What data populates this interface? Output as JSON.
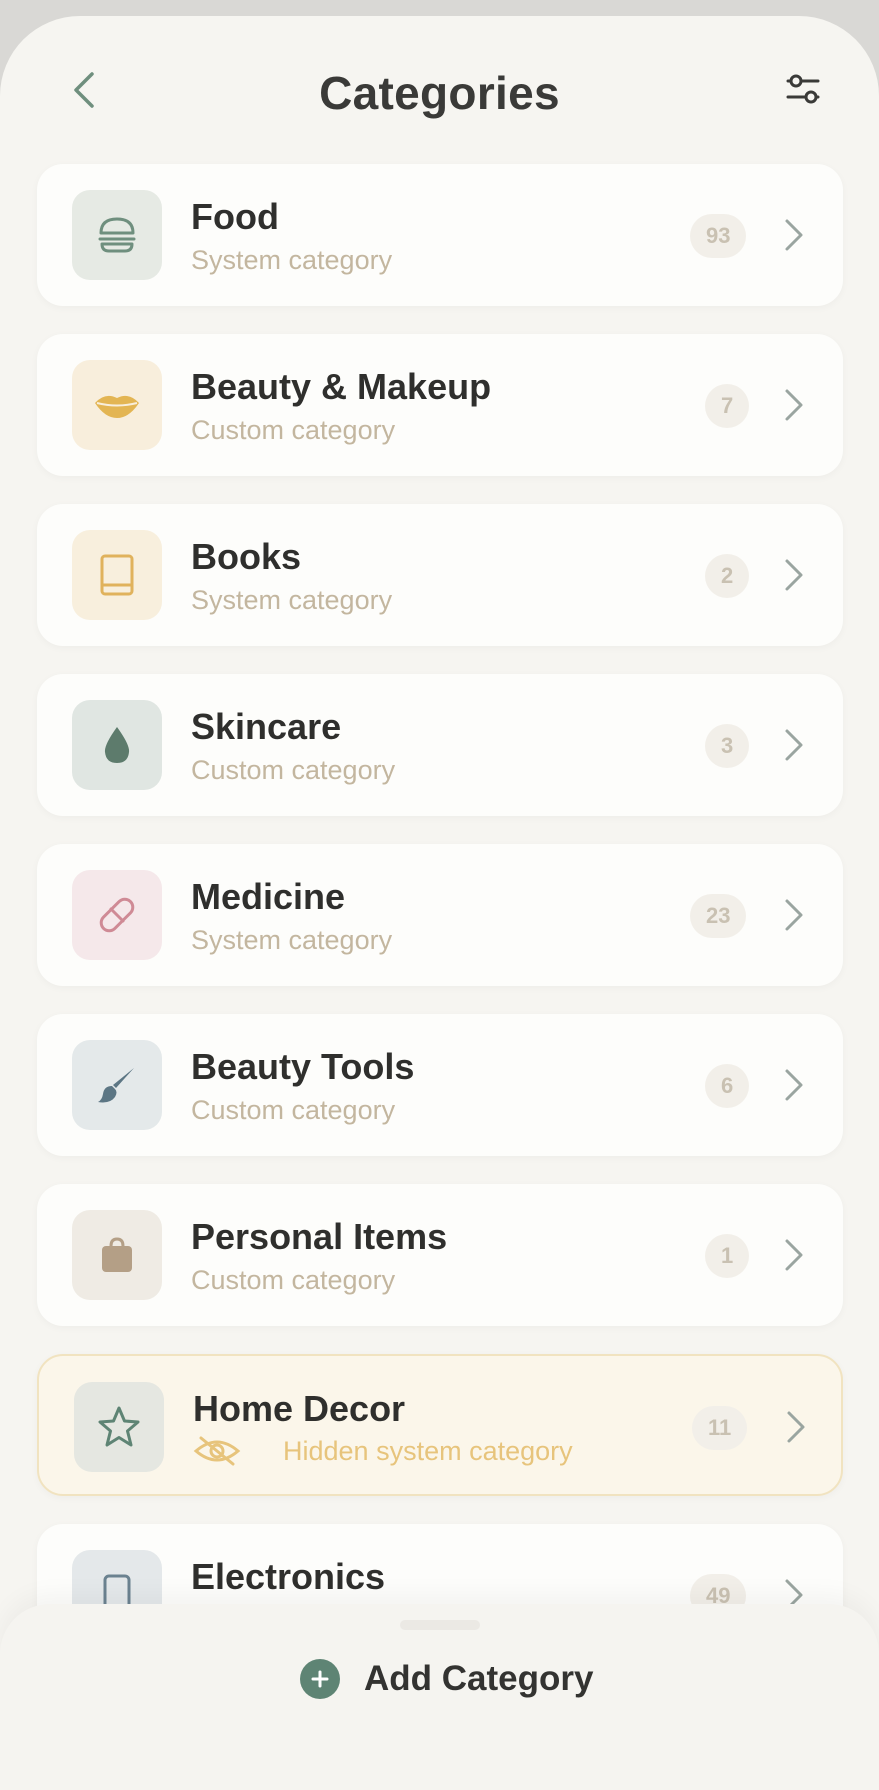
{
  "header": {
    "title": "Categories"
  },
  "categories": [
    {
      "name": "Food",
      "subtitle": "System category",
      "count": "93",
      "icon": "burger-icon",
      "icon_bg": "#e6eae4",
      "icon_color": "#6f8f7e"
    },
    {
      "name": "Beauty & Makeup",
      "subtitle": "Custom category",
      "count": "7",
      "icon": "lips-icon",
      "icon_bg": "#f8eedc",
      "icon_color": "#e3b553"
    },
    {
      "name": "Books",
      "subtitle": "System category",
      "count": "2",
      "icon": "book-icon",
      "icon_bg": "#f8efdd",
      "icon_color": "#e0b25c"
    },
    {
      "name": "Skincare",
      "subtitle": "Custom category",
      "count": "3",
      "icon": "drop-icon",
      "icon_bg": "#e0e6e2",
      "icon_color": "#5d7b6c"
    },
    {
      "name": "Medicine",
      "subtitle": "System category",
      "count": "23",
      "icon": "pill-icon",
      "icon_bg": "#f5e8ea",
      "icon_color": "#cf8a95"
    },
    {
      "name": "Beauty Tools",
      "subtitle": "Custom category",
      "count": "6",
      "icon": "brush-icon",
      "icon_bg": "#e4e9ea",
      "icon_color": "#5c7684"
    },
    {
      "name": "Personal Items",
      "subtitle": "Custom category",
      "count": "1",
      "icon": "bag-icon",
      "icon_bg": "#efebe4",
      "icon_color": "#b49f86"
    },
    {
      "name": "Home Decor",
      "subtitle": "Hidden system category",
      "count": "11",
      "icon": "star-icon",
      "icon_bg": "#e5e7e1",
      "icon_color": "#5e8474",
      "hidden": true
    },
    {
      "name": "Electronics",
      "count": "49",
      "icon": "phone-icon",
      "icon_bg": "#e4e8ea",
      "icon_color": "#6b8290"
    }
  ],
  "footer": {
    "add_label": "Add Category"
  },
  "colors": {
    "accent": "#5e8474",
    "background": "#f6f5f1",
    "hidden_highlight": "#e7c47c"
  }
}
